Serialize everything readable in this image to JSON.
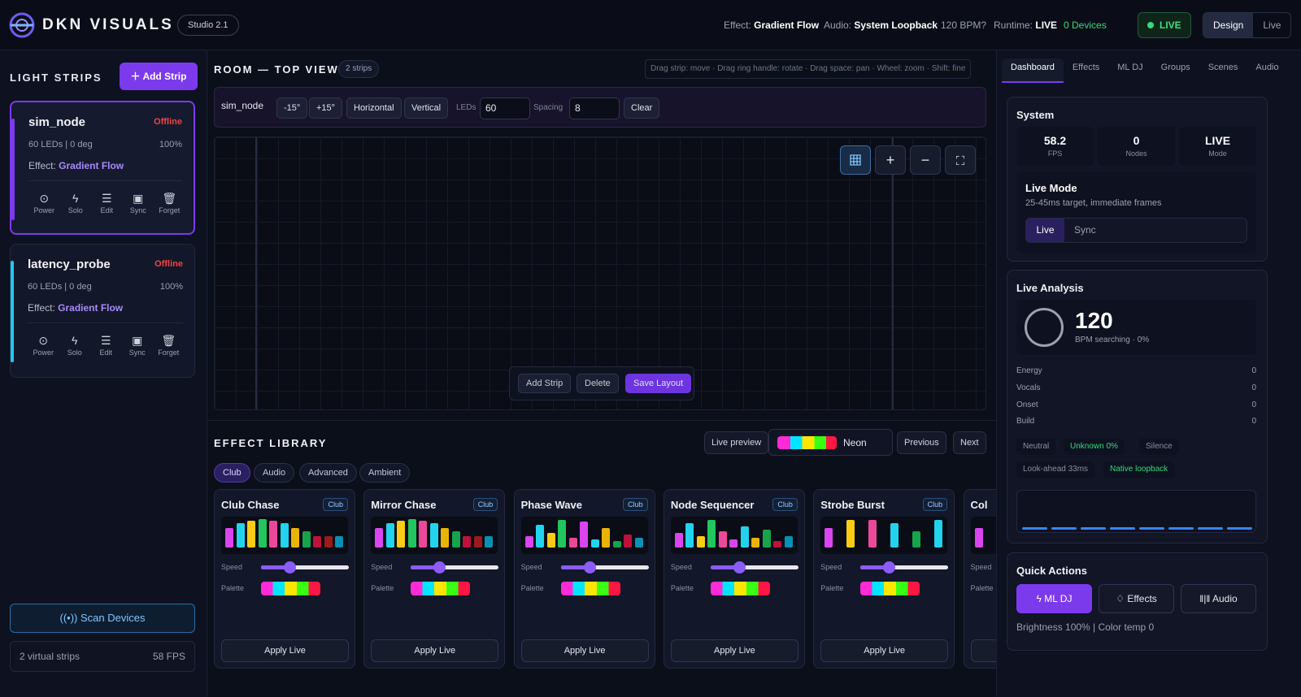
{
  "header": {
    "brand": "DKN VISUALS",
    "studio": "Studio 2.1",
    "effect_label": "Effect:",
    "effect_value": "Gradient Flow",
    "audio_label": "Audio:",
    "audio_value": "System Loopback",
    "bpm": "120 BPM?",
    "runtime_label": "Runtime:",
    "runtime_value": "LIVE",
    "devices": "0 Devices",
    "live_pill": "LIVE",
    "mode_design": "Design",
    "mode_live": "Live"
  },
  "sidebar": {
    "title": "LIGHT STRIPS",
    "add_strip": "Add Strip",
    "strips": [
      {
        "name": "sim_node",
        "status": "Offline",
        "info": "60 LEDs | 0 deg",
        "pct": "100%",
        "effect_label": "Effect:",
        "effect": "Gradient Flow",
        "accent": "#7c3aed"
      },
      {
        "name": "latency_probe",
        "status": "Offline",
        "info": "60 LEDs | 0 deg",
        "pct": "100%",
        "effect_label": "Effect:",
        "effect": "Gradient Flow",
        "accent": "#22c5f0"
      }
    ],
    "actions": [
      "Power",
      "Solo",
      "Edit",
      "Sync",
      "Forget"
    ],
    "scan": "Scan Devices",
    "footer_left": "2 virtual strips",
    "footer_right": "58 FPS"
  },
  "room": {
    "title": "ROOM — TOP VIEW",
    "badge": "2 strips",
    "hint": "Drag strip: move · Drag ring handle: rotate · Drag space: pan · Wheel: zoom · Shift: fine",
    "selected": "sim_node",
    "rot_minus": "-15°",
    "rot_plus": "+15°",
    "horizontal": "Horizontal",
    "vertical": "Vertical",
    "leds_label": "LEDs",
    "leds_value": "60",
    "spacing_label": "Spacing",
    "spacing_value": "8",
    "clear": "Clear",
    "add_strip": "Add Strip",
    "delete": "Delete",
    "save_layout": "Save Layout"
  },
  "library": {
    "title": "EFFECT LIBRARY",
    "live_preview": "Live preview",
    "palette_name": "Neon",
    "previous": "Previous",
    "next": "Next",
    "filters": [
      "Club",
      "Audio",
      "Advanced",
      "Ambient"
    ],
    "speed_label": "Speed",
    "palette_label": "Palette",
    "apply": "Apply Live",
    "effects": [
      {
        "name": "Club Chase",
        "tag": "Club"
      },
      {
        "name": "Mirror Chase",
        "tag": "Club"
      },
      {
        "name": "Phase Wave",
        "tag": "Club"
      },
      {
        "name": "Node Sequencer",
        "tag": "Club"
      },
      {
        "name": "Strobe Burst",
        "tag": "Club"
      },
      {
        "name": "Col",
        "tag": ""
      }
    ]
  },
  "right": {
    "tabs": [
      "Dashboard",
      "Effects",
      "ML DJ",
      "Groups",
      "Scenes",
      "Audio"
    ],
    "system_title": "System",
    "fps_value": "58.2",
    "fps_label": "FPS",
    "nodes_value": "0",
    "nodes_label": "Nodes",
    "mode_value": "LIVE",
    "mode_label": "Mode",
    "live_mode_title": "Live Mode",
    "live_mode_sub": "25-45ms target, immediate frames",
    "seg_live": "Live",
    "seg_sync": "Sync",
    "analysis_title": "Live Analysis",
    "bpm_value": "120",
    "bpm_sub": "BPM searching · 0%",
    "metrics": [
      {
        "label": "Energy",
        "value": "0"
      },
      {
        "label": "Vocals",
        "value": "0"
      },
      {
        "label": "Onset",
        "value": "0"
      },
      {
        "label": "Build",
        "value": "0"
      }
    ],
    "tags1": [
      "Neutral",
      "Unknown 0%",
      "Silence"
    ],
    "tags2": [
      "Look-ahead 33ms",
      "Native loopback"
    ],
    "quick_title": "Quick Actions",
    "q_mldj": "ML DJ",
    "q_effects": "Effects",
    "q_audio": "Audio",
    "brightness": "Brightness 100% | Color temp 0"
  }
}
